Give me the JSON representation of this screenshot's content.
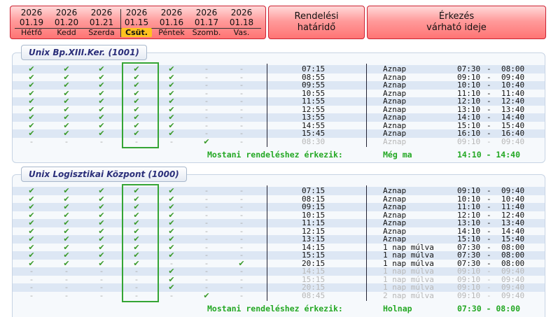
{
  "header": {
    "days": [
      {
        "year": "2026",
        "md": "01.19",
        "name": "Hétfő",
        "today": false
      },
      {
        "year": "2026",
        "md": "01.20",
        "name": "Kedd",
        "today": false
      },
      {
        "year": "2026",
        "md": "01.21",
        "name": "Szerda",
        "today": false
      },
      {
        "year": "2026",
        "md": "01.15",
        "name": "Csüt.",
        "today": true
      },
      {
        "year": "2026",
        "md": "01.16",
        "name": "Péntek",
        "today": false
      },
      {
        "year": "2026",
        "md": "01.17",
        "name": "Szomb.",
        "today": false
      },
      {
        "year": "2026",
        "md": "01.18",
        "name": "Vas.",
        "today": false
      }
    ],
    "deadline_title_1": "Rendelési",
    "deadline_title_2": "határidő",
    "arrival_title_1": "Érkezés",
    "arrival_title_2": "várható ideje"
  },
  "colors": {
    "check": "#3a9a2a",
    "highlight": "#35a535",
    "header_red": "#ff7474",
    "today_badge": "#ffc21f",
    "footer_green": "#24a824"
  },
  "icons": {
    "available": "check-icon",
    "unavailable": "dash-icon"
  },
  "panels": [
    {
      "title": "Unix Bp.XIII.Ker. (1001)",
      "rows": [
        {
          "days": [
            1,
            1,
            1,
            1,
            1,
            0,
            0
          ],
          "deadline": "07:15",
          "day": "Aznap",
          "from": "07:30",
          "to": "08:00",
          "muted": false
        },
        {
          "days": [
            1,
            1,
            1,
            1,
            1,
            0,
            0
          ],
          "deadline": "08:55",
          "day": "Aznap",
          "from": "09:10",
          "to": "09:40",
          "muted": false
        },
        {
          "days": [
            1,
            1,
            1,
            1,
            1,
            0,
            0
          ],
          "deadline": "09:55",
          "day": "Aznap",
          "from": "10:10",
          "to": "10:40",
          "muted": false
        },
        {
          "days": [
            1,
            1,
            1,
            1,
            1,
            0,
            0
          ],
          "deadline": "10:55",
          "day": "Aznap",
          "from": "11:10",
          "to": "11:40",
          "muted": false
        },
        {
          "days": [
            1,
            1,
            1,
            1,
            1,
            0,
            0
          ],
          "deadline": "11:55",
          "day": "Aznap",
          "from": "12:10",
          "to": "12:40",
          "muted": false
        },
        {
          "days": [
            1,
            1,
            1,
            1,
            1,
            0,
            0
          ],
          "deadline": "12:55",
          "day": "Aznap",
          "from": "13:10",
          "to": "13:40",
          "muted": false
        },
        {
          "days": [
            1,
            1,
            1,
            1,
            1,
            0,
            0
          ],
          "deadline": "13:55",
          "day": "Aznap",
          "from": "14:10",
          "to": "14:40",
          "muted": false
        },
        {
          "days": [
            1,
            1,
            1,
            1,
            1,
            0,
            0
          ],
          "deadline": "14:55",
          "day": "Aznap",
          "from": "15:10",
          "to": "15:40",
          "muted": false
        },
        {
          "days": [
            1,
            1,
            1,
            1,
            1,
            0,
            0
          ],
          "deadline": "15:45",
          "day": "Aznap",
          "from": "16:10",
          "to": "16:40",
          "muted": false
        },
        {
          "days": [
            0,
            0,
            0,
            0,
            0,
            1,
            0
          ],
          "deadline": "08:30",
          "day": "Aznap",
          "from": "09:10",
          "to": "09:40",
          "muted": true
        }
      ],
      "footer_label": "Mostani rendeléshez érkezik:",
      "footer_day": "Még ma",
      "footer_time": "14:10 - 14:40"
    },
    {
      "title": "Unix Logisztikai Központ (1000)",
      "rows": [
        {
          "days": [
            1,
            1,
            1,
            1,
            1,
            0,
            0
          ],
          "deadline": "07:15",
          "day": "Aznap",
          "from": "09:10",
          "to": "09:40",
          "muted": false
        },
        {
          "days": [
            1,
            1,
            1,
            1,
            1,
            0,
            0
          ],
          "deadline": "08:15",
          "day": "Aznap",
          "from": "10:10",
          "to": "10:40",
          "muted": false
        },
        {
          "days": [
            1,
            1,
            1,
            1,
            1,
            0,
            0
          ],
          "deadline": "09:15",
          "day": "Aznap",
          "from": "11:10",
          "to": "11:40",
          "muted": false
        },
        {
          "days": [
            1,
            1,
            1,
            1,
            1,
            0,
            0
          ],
          "deadline": "10:15",
          "day": "Aznap",
          "from": "12:10",
          "to": "12:40",
          "muted": false
        },
        {
          "days": [
            1,
            1,
            1,
            1,
            1,
            0,
            0
          ],
          "deadline": "11:15",
          "day": "Aznap",
          "from": "13:10",
          "to": "13:40",
          "muted": false
        },
        {
          "days": [
            1,
            1,
            1,
            1,
            1,
            0,
            0
          ],
          "deadline": "12:15",
          "day": "Aznap",
          "from": "14:10",
          "to": "14:40",
          "muted": false
        },
        {
          "days": [
            1,
            1,
            1,
            1,
            1,
            0,
            0
          ],
          "deadline": "13:15",
          "day": "Aznap",
          "from": "15:10",
          "to": "15:40",
          "muted": false
        },
        {
          "days": [
            1,
            1,
            1,
            1,
            1,
            0,
            0
          ],
          "deadline": "14:15",
          "day": "1 nap múlva",
          "from": "07:30",
          "to": "08:00",
          "muted": false
        },
        {
          "days": [
            1,
            1,
            1,
            1,
            1,
            0,
            0
          ],
          "deadline": "15:15",
          "day": "1 nap múlva",
          "from": "07:30",
          "to": "08:00",
          "muted": false
        },
        {
          "days": [
            1,
            1,
            1,
            1,
            0,
            0,
            1
          ],
          "deadline": "20:15",
          "day": "1 nap múlva",
          "from": "07:30",
          "to": "08:00",
          "muted": false
        },
        {
          "days": [
            0,
            0,
            0,
            0,
            1,
            0,
            0
          ],
          "deadline": "14:15",
          "day": "1 nap múlva",
          "from": "09:10",
          "to": "09:40",
          "muted": true
        },
        {
          "days": [
            0,
            0,
            0,
            0,
            1,
            0,
            0
          ],
          "deadline": "15:15",
          "day": "1 nap múlva",
          "from": "09:10",
          "to": "09:40",
          "muted": true
        },
        {
          "days": [
            0,
            0,
            0,
            0,
            1,
            0,
            0
          ],
          "deadline": "20:15",
          "day": "1 nap múlva",
          "from": "09:10",
          "to": "09:40",
          "muted": true
        },
        {
          "days": [
            0,
            0,
            0,
            0,
            0,
            1,
            0
          ],
          "deadline": "08:45",
          "day": "2 nap múlva",
          "from": "09:10",
          "to": "09:40",
          "muted": true
        }
      ],
      "footer_label": "Mostani rendeléshez érkezik:",
      "footer_day": "Holnap",
      "footer_time": "07:30 - 08:00"
    }
  ]
}
